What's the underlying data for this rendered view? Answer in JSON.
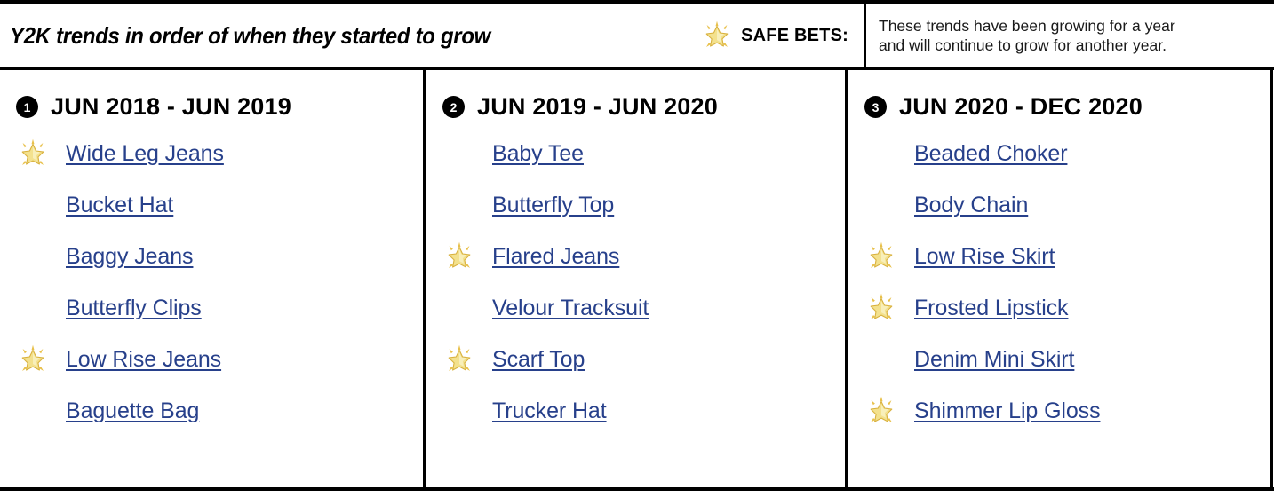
{
  "header": {
    "title": "Y2K trends in order of when they started to grow",
    "safe_bets_label": "SAFE BETS:",
    "safe_bets_icon": "glowing-star-icon",
    "note_line_1": "These trends have been growing for a year",
    "note_line_2": "and will continue to grow for another year."
  },
  "colors": {
    "link": "#27408B",
    "rule": "#000000",
    "badge_bg": "#000000",
    "badge_fg": "#FFFFFF",
    "star_fill": "#F5E49B",
    "star_stroke": "#D9B84A",
    "background": "#FFFFFF"
  },
  "columns": [
    {
      "number": "1",
      "badge_glyph": "1",
      "title": "JUN 2018 - JUN 2019",
      "items": [
        {
          "label": "Wide Leg Jeans",
          "safe_bet": true
        },
        {
          "label": "Bucket Hat",
          "safe_bet": false
        },
        {
          "label": "Baggy Jeans",
          "safe_bet": false
        },
        {
          "label": "Butterfly Clips",
          "safe_bet": false
        },
        {
          "label": "Low Rise Jeans",
          "safe_bet": true
        },
        {
          "label": "Baguette Bag",
          "safe_bet": false
        }
      ]
    },
    {
      "number": "2",
      "badge_glyph": "2",
      "title": "JUN 2019 - JUN 2020",
      "items": [
        {
          "label": "Baby Tee",
          "safe_bet": false
        },
        {
          "label": "Butterfly Top",
          "safe_bet": false
        },
        {
          "label": "Flared Jeans",
          "safe_bet": true
        },
        {
          "label": "Velour Tracksuit",
          "safe_bet": false
        },
        {
          "label": "Scarf Top",
          "safe_bet": true
        },
        {
          "label": "Trucker Hat",
          "safe_bet": false
        }
      ]
    },
    {
      "number": "3",
      "badge_glyph": "3",
      "title": "JUN 2020 - DEC 2020",
      "items": [
        {
          "label": "Beaded Choker",
          "safe_bet": false
        },
        {
          "label": "Body Chain",
          "safe_bet": false
        },
        {
          "label": "Low Rise Skirt",
          "safe_bet": true
        },
        {
          "label": "Frosted Lipstick",
          "safe_bet": true
        },
        {
          "label": "Denim Mini Skirt",
          "safe_bet": false
        },
        {
          "label": "Shimmer Lip Gloss",
          "safe_bet": true
        }
      ]
    }
  ]
}
